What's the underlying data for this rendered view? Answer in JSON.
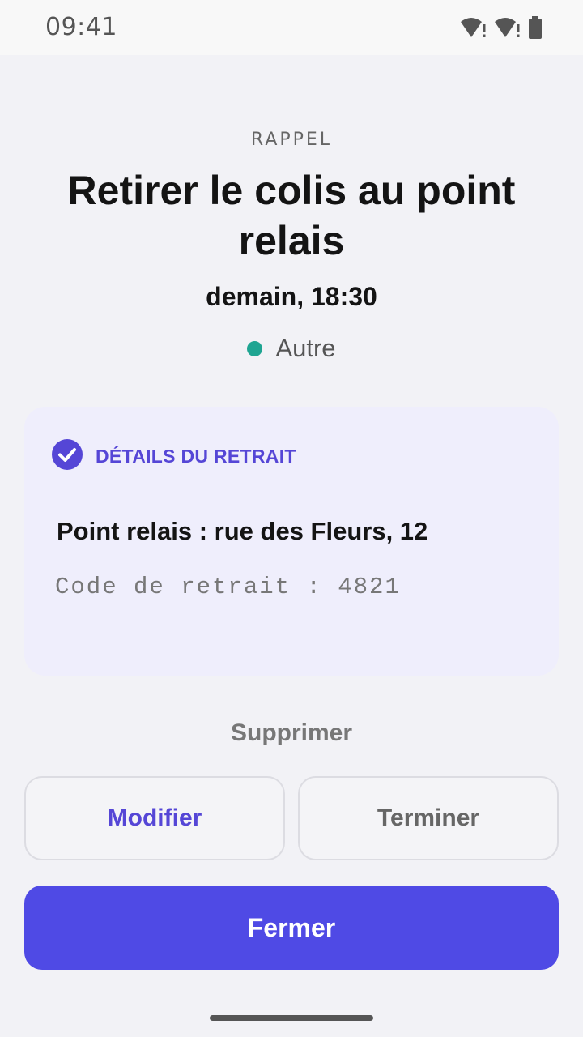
{
  "status_bar": {
    "time": "09:41",
    "icons": [
      "wifi-alert-icon",
      "wifi-alert-icon",
      "battery-icon"
    ]
  },
  "reminder": {
    "eyebrow": "RAPPEL",
    "title": "Retirer le colis au point relais",
    "when": "demain, 18:30",
    "category": "Autre",
    "category_color": "#1fa592"
  },
  "details": {
    "heading": "DÉTAILS DU RETRAIT",
    "icon": "check-circle-icon",
    "line1": "Point relais : rue des Fleurs, 12",
    "line2": "Code de retrait : 4821"
  },
  "actions": {
    "delete_label": "Supprimer",
    "edit_label": "Modifier",
    "done_label": "Terminer",
    "close_label": "Fermer"
  },
  "colors": {
    "accent": "#4f4ae5",
    "accent_text": "#5546d6",
    "card_bg": "#efeefc"
  }
}
